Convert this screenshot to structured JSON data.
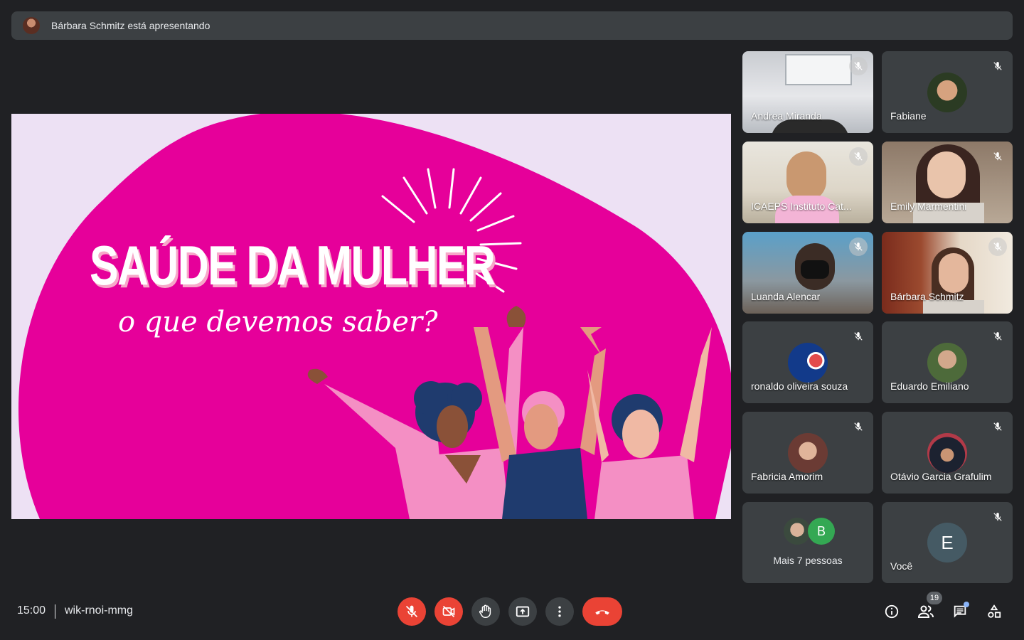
{
  "presenter_bar": {
    "text": "Bárbara Schmitz está apresentando"
  },
  "slide": {
    "title": "SAÚDE DA MULHER",
    "subtitle": "o que devemos saber?",
    "colors": {
      "background": "#ede1f4",
      "blob": "#e6009a",
      "accent": "#f7a8c9"
    }
  },
  "participants": [
    {
      "name": "Andrea Miranda",
      "type": "video",
      "muted": true
    },
    {
      "name": "Fabiane",
      "type": "avatar",
      "muted": true
    },
    {
      "name": "ICAEPS Instituto Cat...",
      "type": "video",
      "muted": true
    },
    {
      "name": "Emily Marmentini",
      "type": "video",
      "muted": true
    },
    {
      "name": "Luanda Alencar",
      "type": "video",
      "muted": true
    },
    {
      "name": "Bárbara Schmitz",
      "type": "video",
      "muted": true
    },
    {
      "name": "ronaldo oliveira souza",
      "type": "avatar",
      "muted": true
    },
    {
      "name": "Eduardo Emiliano",
      "type": "avatar",
      "muted": true
    },
    {
      "name": "Fabricia Amorim",
      "type": "avatar",
      "muted": true
    },
    {
      "name": "Otávio Garcia Grafulim",
      "type": "avatar",
      "muted": true
    }
  ],
  "more_people": {
    "label": "Mais 7 pessoas",
    "initial": "B"
  },
  "self_tile": {
    "name": "Você",
    "initial": "E"
  },
  "meeting": {
    "time": "15:00",
    "code": "wik-rnoi-mmg"
  },
  "controls": {
    "mic": "mic-off-icon",
    "camera": "camera-off-icon",
    "raise_hand": "hand-icon",
    "present": "present-screen-icon",
    "more": "more-vert-icon",
    "hangup": "call-end-icon"
  },
  "right_controls": {
    "people_count": "19"
  }
}
